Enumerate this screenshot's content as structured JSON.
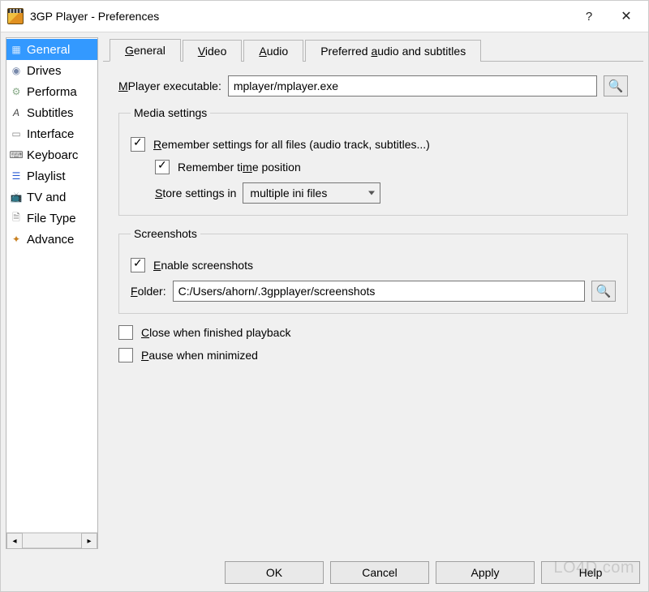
{
  "window": {
    "title": "3GP Player - Preferences"
  },
  "sidebar": {
    "items": [
      {
        "label": "General",
        "icon": "⊞",
        "selected": true
      },
      {
        "label": "Drives",
        "icon": "💿"
      },
      {
        "label": "Performa",
        "icon": "⚙"
      },
      {
        "label": "Subtitles",
        "icon": "A"
      },
      {
        "label": "Interface",
        "icon": "▭"
      },
      {
        "label": "Keyboarc",
        "icon": "⌨"
      },
      {
        "label": "Playlist",
        "icon": "≡"
      },
      {
        "label": "TV and",
        "icon": "🖵"
      },
      {
        "label": "File Type",
        "icon": "📄"
      },
      {
        "label": "Advance",
        "icon": "✦"
      }
    ]
  },
  "tabs": {
    "items": [
      {
        "label": "General",
        "accel": "G",
        "active": true
      },
      {
        "label": "Video",
        "accel": "V"
      },
      {
        "label": "Audio",
        "accel": "A"
      },
      {
        "label": "Preferred audio and subtitles",
        "accel": "a"
      }
    ]
  },
  "general": {
    "mplayer_exec_label": "MPlayer executable:",
    "mplayer_exec_label_acc": "M",
    "mplayer_exec_value": "mplayer/mplayer.exe",
    "media_settings_legend": "Media settings",
    "remember_settings_label": "Remember settings for all files (audio track, subtitles...)",
    "remember_settings_checked": true,
    "remember_time_label": "Remember time position",
    "remember_time_checked": true,
    "store_settings_label": "Store settings in",
    "store_settings_value": "multiple ini files",
    "screenshots_legend": "Screenshots",
    "enable_screenshots_label": "Enable screenshots",
    "enable_screenshots_checked": true,
    "folder_label": "Folder:",
    "folder_value": "C:/Users/ahorn/.3gpplayer/screenshots",
    "close_when_finished_label": "Close when finished playback",
    "close_when_finished_checked": false,
    "pause_when_minimized_label": "Pause when minimized",
    "pause_when_minimized_checked": false
  },
  "buttons": {
    "ok": "OK",
    "cancel": "Cancel",
    "apply": "Apply",
    "help": "Help"
  },
  "watermark": "LO4D.com"
}
